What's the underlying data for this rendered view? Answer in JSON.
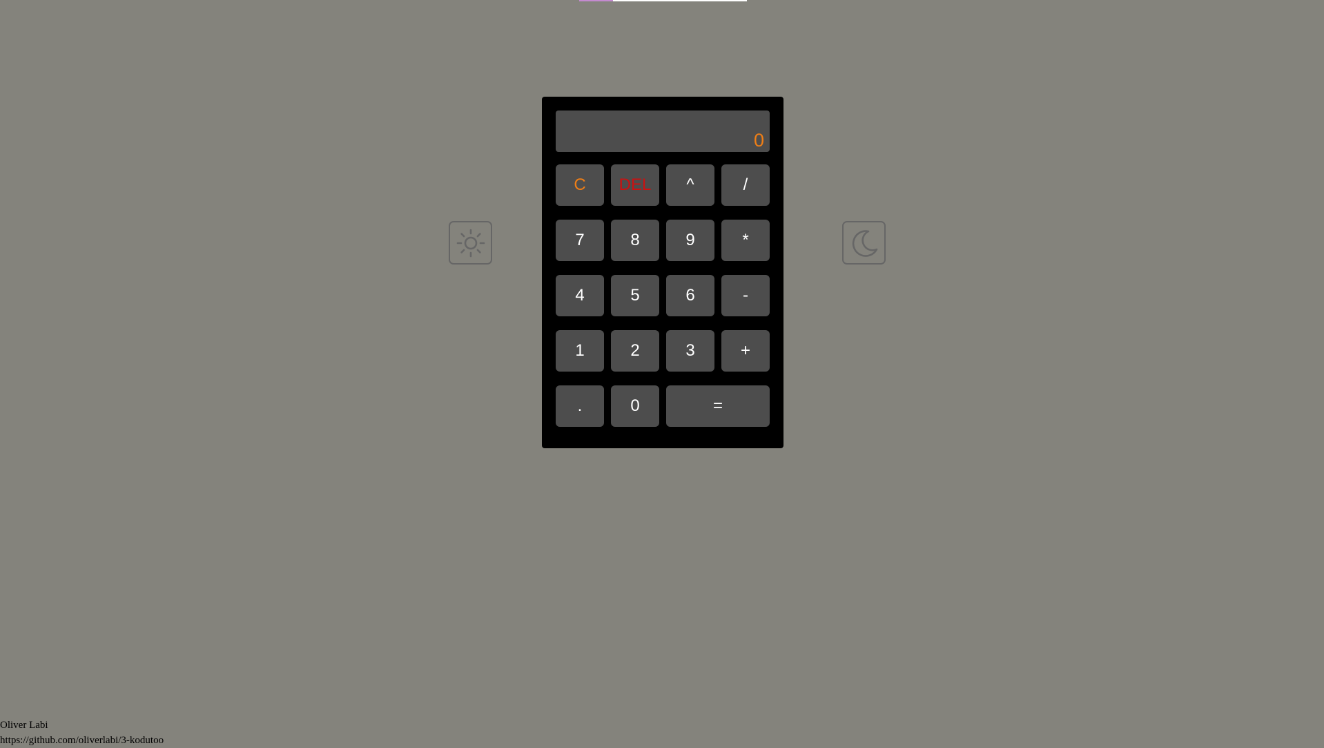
{
  "display": {
    "value": "0"
  },
  "theme": {
    "light_icon": "sun-icon",
    "dark_icon": "moon-icon"
  },
  "keys": {
    "clear": "C",
    "delete": "DEL",
    "power": "^",
    "divide": "/",
    "seven": "7",
    "eight": "8",
    "nine": "9",
    "multiply": "*",
    "four": "4",
    "five": "5",
    "six": "6",
    "subtract": "-",
    "one": "1",
    "two": "2",
    "three": "3",
    "add": "+",
    "decimal": ".",
    "zero": "0",
    "equals": "="
  },
  "footer": {
    "author": "Oliver Labi",
    "link": "https://github.com/oliverlabi/3-kodutoo"
  },
  "colors": {
    "background": "#84837c",
    "calculator": "#000000",
    "key": "#4d4d4d",
    "accent": "#f07f16",
    "delete": "#cc1111"
  }
}
